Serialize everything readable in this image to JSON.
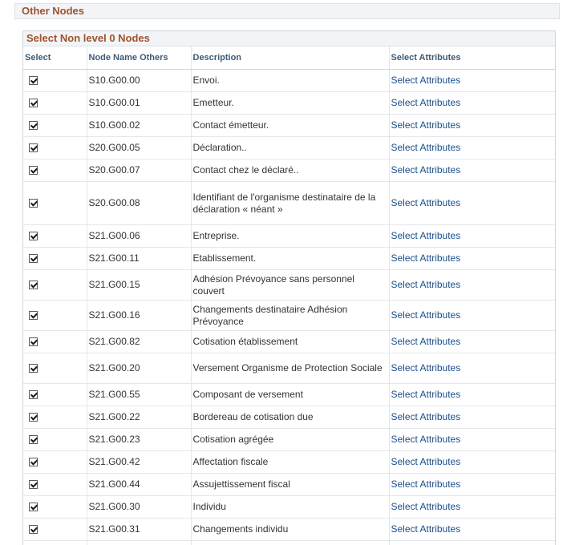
{
  "section": {
    "title": "Other Nodes"
  },
  "grid": {
    "title": "Select Non level 0 Nodes",
    "columns": {
      "select": "Select",
      "node_name": "Node Name Others",
      "description": "Description",
      "attributes": "Select Attributes"
    },
    "rows": [
      {
        "checked": true,
        "node": "S10.G00.00",
        "description": "Envoi.",
        "link": "Select Attributes"
      },
      {
        "checked": true,
        "node": "S10.G00.01",
        "description": "Emetteur.",
        "link": "Select Attributes"
      },
      {
        "checked": true,
        "node": "S10.G00.02",
        "description": "Contact émetteur.",
        "link": "Select Attributes"
      },
      {
        "checked": true,
        "node": "S20.G00.05",
        "description": "Déclaration..",
        "link": "Select Attributes"
      },
      {
        "checked": true,
        "node": "S20.G00.07",
        "description": "Contact chez le déclaré..",
        "link": "Select Attributes"
      },
      {
        "checked": true,
        "node": "S20.G00.08",
        "description": "Identifiant de l'organisme destinataire de la déclaration « néant »",
        "link": "Select Attributes"
      },
      {
        "checked": true,
        "node": "S21.G00.06",
        "description": "Entreprise.",
        "link": "Select Attributes"
      },
      {
        "checked": true,
        "node": "S21.G00.11",
        "description": "Etablissement.",
        "link": "Select Attributes"
      },
      {
        "checked": true,
        "node": "S21.G00.15",
        "description": "Adhésion Prévoyance sans personnel couvert",
        "link": "Select Attributes"
      },
      {
        "checked": true,
        "node": "S21.G00.16",
        "description": "Changements destinataire Adhésion Prévoyance",
        "link": "Select Attributes"
      },
      {
        "checked": true,
        "node": "S21.G00.82",
        "description": "Cotisation établissement",
        "link": "Select Attributes"
      },
      {
        "checked": true,
        "node": "S21.G00.20",
        "description": "Versement Organisme de Protection Sociale",
        "link": "Select Attributes"
      },
      {
        "checked": true,
        "node": "S21.G00.55",
        "description": "Composant de versement",
        "link": "Select Attributes"
      },
      {
        "checked": true,
        "node": "S21.G00.22",
        "description": "Bordereau de cotisation due",
        "link": "Select Attributes"
      },
      {
        "checked": true,
        "node": "S21.G00.23",
        "description": "Cotisation agrégée",
        "link": "Select Attributes"
      },
      {
        "checked": true,
        "node": "S21.G00.42",
        "description": "Affectation fiscale",
        "link": "Select Attributes"
      },
      {
        "checked": true,
        "node": "S21.G00.44",
        "description": "Assujettissement fiscal",
        "link": "Select Attributes"
      },
      {
        "checked": true,
        "node": "S21.G00.30",
        "description": "Individu",
        "link": "Select Attributes"
      },
      {
        "checked": true,
        "node": "S21.G00.31",
        "description": "Changements individu",
        "link": "Select Attributes"
      },
      {
        "checked": true,
        "node": "",
        "description": "",
        "link": ""
      }
    ]
  }
}
